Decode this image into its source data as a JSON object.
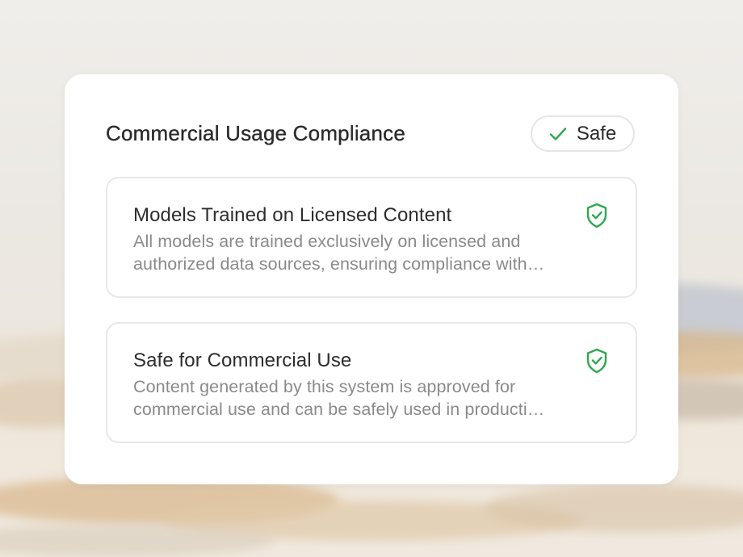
{
  "panel": {
    "title": "Commercial Usage Compliance",
    "status": {
      "label": "Safe",
      "icon": "check-icon",
      "color": "#2fa84f"
    }
  },
  "items": [
    {
      "title": "Models Trained on Licensed Content",
      "description": "All models are trained exclusively on licensed and authorized data sources, ensuring compliance with…",
      "icon": "shield-check-icon"
    },
    {
      "title": "Safe for Commercial Use",
      "description": "Content generated by this system is approved for commercial use and can be safely used in producti…",
      "icon": "shield-check-icon"
    }
  ],
  "colors": {
    "accent_green": "#2fa84f",
    "card_background": "#ffffff",
    "title_text": "#2b2b2b",
    "description_text": "#8a8a8a",
    "border": "#e6e6e6"
  }
}
